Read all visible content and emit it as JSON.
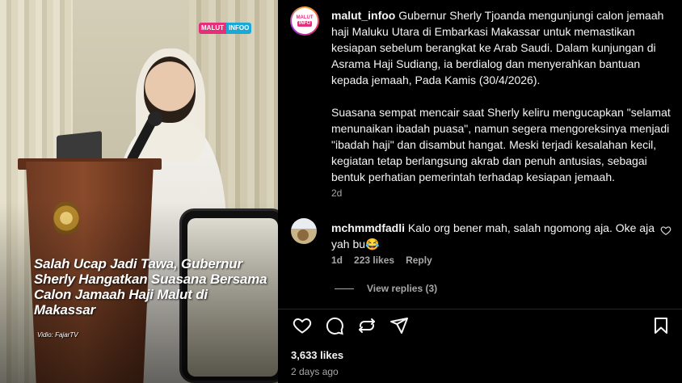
{
  "media": {
    "watermark_a": "MALUT",
    "watermark_b": "INFOO",
    "headline": "Salah Ucap Jadi Tawa, Gubernur Sherly Hangatkan Suasana Bersama Calon Jamaah Haji Malut di Makassar",
    "credit": "Vidio: FajarTV"
  },
  "post": {
    "avatar_top": "MALUT",
    "avatar_bottom": "INFO",
    "username": "malut_infoo",
    "caption_p1": "Gubernur Sherly Tjoanda mengunjungi calon jemaah haji Maluku Utara di Embarkasi Makassar untuk memastikan kesiapan sebelum berangkat ke Arab Saudi. Dalam kunjungan di Asrama Haji Sudiang, ia berdialog dan menyerahkan bantuan kepada jemaah, Pada Kamis (30/4/2026).",
    "caption_p2": "Suasana sempat mencair saat Sherly keliru mengucapkan \"selamat menunaikan ibadah puasa\", namun segera mengoreksinya menjadi \"ibadah haji\" dan disambut hangat. Meski terjadi kesalahan kecil, kegiatan tetap berlangsung akrab dan penuh antusias, sebagai bentuk perhatian pemerintah terhadap kesiapan jemaah.",
    "caption_time": "2d"
  },
  "comment": {
    "username": "mchmmdfadli",
    "text": "Kalo org bener mah, salah ngomong aja. Oke aja yah bu😂",
    "time": "1d",
    "likes": "223 likes",
    "reply": "Reply",
    "view_replies": "View replies (3)"
  },
  "footer": {
    "likes": "3,633 likes",
    "date": "2 days ago"
  },
  "icons": [
    "heart-icon",
    "comment-icon",
    "repost-icon",
    "share-icon",
    "bookmark-icon"
  ]
}
